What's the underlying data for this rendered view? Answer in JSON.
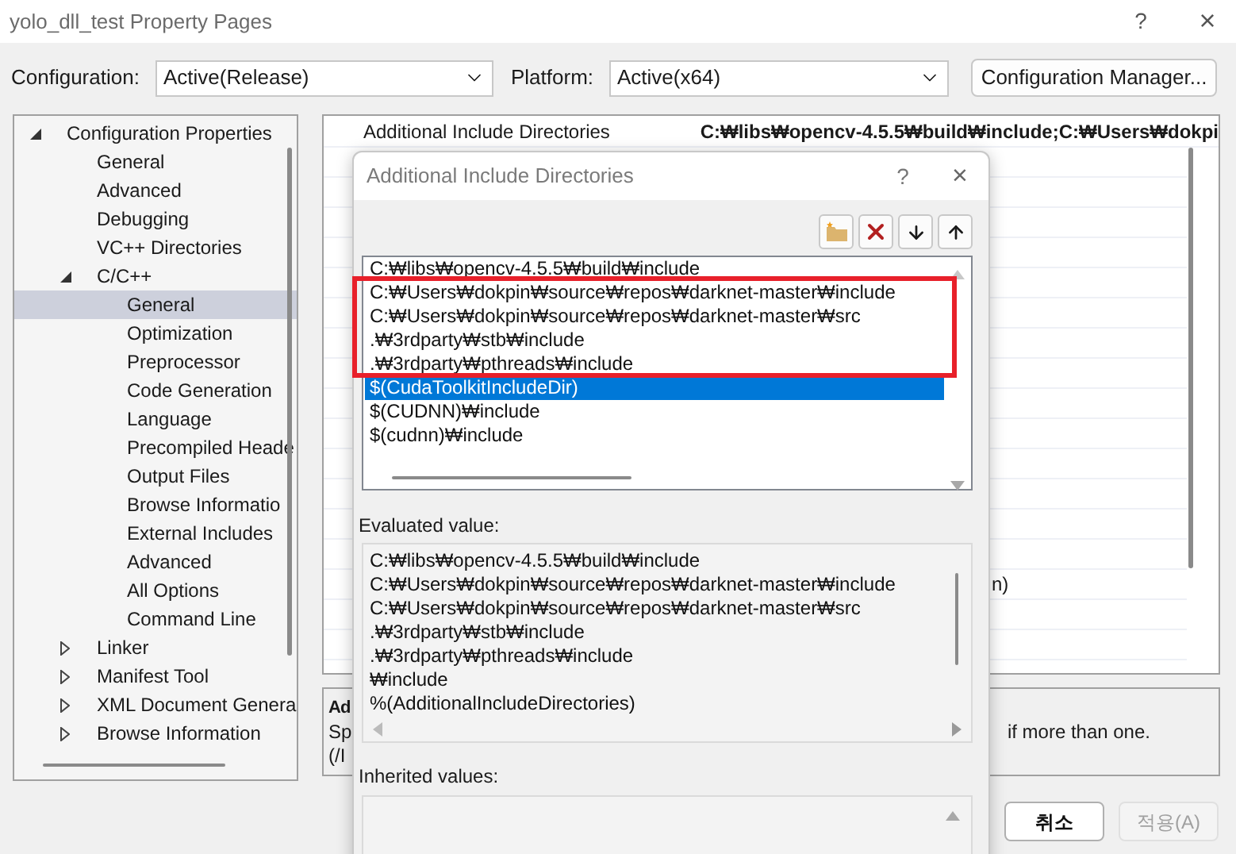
{
  "window": {
    "title": "yolo_dll_test Property Pages",
    "help": "?",
    "close": "×"
  },
  "configuration": {
    "label": "Configuration:",
    "value": "Active(Release)"
  },
  "platform": {
    "label": "Platform:",
    "value": "Active(x64)"
  },
  "configuration_manager": "Configuration Manager...",
  "tree": [
    {
      "label": "Configuration Properties",
      "expanded": true,
      "selected": false,
      "children": [
        {
          "label": "General",
          "selected": false
        },
        {
          "label": "Advanced",
          "selected": false
        },
        {
          "label": "Debugging",
          "selected": false
        },
        {
          "label": "VC++ Directories",
          "selected": false
        },
        {
          "label": "C/C++",
          "expanded": true,
          "selected": false,
          "children": [
            {
              "label": "General",
              "selected": true
            },
            {
              "label": "Optimization",
              "selected": false
            },
            {
              "label": "Preprocessor",
              "selected": false
            },
            {
              "label": "Code Generation",
              "selected": false
            },
            {
              "label": "Language",
              "selected": false
            },
            {
              "label": "Precompiled Heade",
              "selected": false
            },
            {
              "label": "Output Files",
              "selected": false
            },
            {
              "label": "Browse Informatio",
              "selected": false
            },
            {
              "label": "External Includes",
              "selected": false
            },
            {
              "label": "Advanced",
              "selected": false
            },
            {
              "label": "All Options",
              "selected": false
            },
            {
              "label": "Command Line",
              "selected": false
            }
          ]
        },
        {
          "label": "Linker",
          "expanded": false,
          "selected": false
        },
        {
          "label": "Manifest Tool",
          "expanded": false,
          "selected": false
        },
        {
          "label": "XML Document Genera",
          "expanded": false,
          "selected": false
        },
        {
          "label": "Browse Information",
          "expanded": false,
          "selected": false
        }
      ]
    }
  ],
  "property_grid": {
    "name": "Additional Include Directories",
    "value": "C:₩libs₩opencv-4.5.5₩build₩include;C:₩Users₩dokpi",
    "covered_row_tail": "n)"
  },
  "description": {
    "title_fragment": "Ad",
    "text_fragments": [
      "Sp",
      "(/I"
    ],
    "text_tail": "if more than one."
  },
  "buttons": [
    {
      "label": "취소",
      "disabled": false
    },
    {
      "label": "적용(A)",
      "disabled": true
    }
  ],
  "dialog": {
    "title": "Additional Include Directories",
    "help": "?",
    "close": "×",
    "entries": [
      {
        "text": "C:₩libs₩opencv-4.5.5₩build₩include",
        "selected": false
      },
      {
        "text": "C:₩Users₩dokpin₩source₩repos₩darknet-master₩include",
        "selected": false
      },
      {
        "text": "C:₩Users₩dokpin₩source₩repos₩darknet-master₩src",
        "selected": false
      },
      {
        "text": ".₩3rdparty₩stb₩include",
        "selected": false
      },
      {
        "text": ".₩3rdparty₩pthreads₩include",
        "selected": false
      },
      {
        "text": "$(CudaToolkitIncludeDir)",
        "selected": true
      },
      {
        "text": "$(CUDNN)₩include",
        "selected": false
      },
      {
        "text": "$(cudnn)₩include",
        "selected": false
      }
    ],
    "evaluated_label": "Evaluated value:",
    "evaluated_lines": [
      "C:₩libs₩opencv-4.5.5₩build₩include",
      "C:₩Users₩dokpin₩source₩repos₩darknet-master₩include",
      "C:₩Users₩dokpin₩source₩repos₩darknet-master₩src",
      ".₩3rdparty₩stb₩include",
      ".₩3rdparty₩pthreads₩include",
      "₩include",
      "%(AdditionalIncludeDirectories)"
    ],
    "inherited_label": "Inherited values:"
  }
}
